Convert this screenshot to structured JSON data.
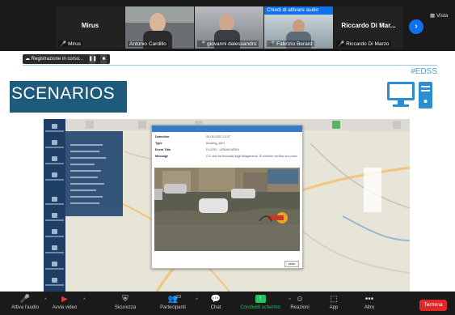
{
  "participants": [
    {
      "display_name": "Mirus",
      "label": "Mirus"
    },
    {
      "display_name": "",
      "label": "Antonio Cardillo"
    },
    {
      "display_name": "",
      "label": "giovanni dalessandro"
    },
    {
      "display_name": "",
      "label": "Fabrizio Berard",
      "banner": "Chiedi di attivare audio"
    },
    {
      "display_name": "Riccardo Di Mar...",
      "label": "Riccardo Di Marzo"
    }
  ],
  "view_label": "Vista",
  "recording": {
    "label": "Registrazione in corso...",
    "pause": "❚❚",
    "stop": "■"
  },
  "slide": {
    "hashtag": "#EDSS",
    "title": "SCENARIOS"
  },
  "popup": {
    "rows": [
      {
        "label": "Detection",
        "value": "25-05-2022 13:37"
      },
      {
        "label": "Type",
        "value": "flooding_alert"
      },
      {
        "label": "Event Title",
        "value": "FLOOD - URBAN AREA"
      },
      {
        "label": "Message",
        "value": "C'è una via bloccata dagli allagamenti. Si richiede verifica sul posto"
      }
    ],
    "close_label": "close"
  },
  "toolbar": {
    "audio": "Attiva l'audio",
    "video": "Avvia video",
    "security": "Sicurezza",
    "participants": "Partecipanti",
    "participants_count": "23",
    "chat": "Chat",
    "share": "Condividi schermo",
    "reactions": "Reazioni",
    "apps": "App",
    "more": "Altro",
    "end": "Termina"
  },
  "colors": {
    "accent_blue": "#0e71eb",
    "share_green": "#26c461",
    "end_red": "#e02828",
    "slide_title_bg": "#1e5a7a",
    "mic_muted": "#e03b3b"
  }
}
